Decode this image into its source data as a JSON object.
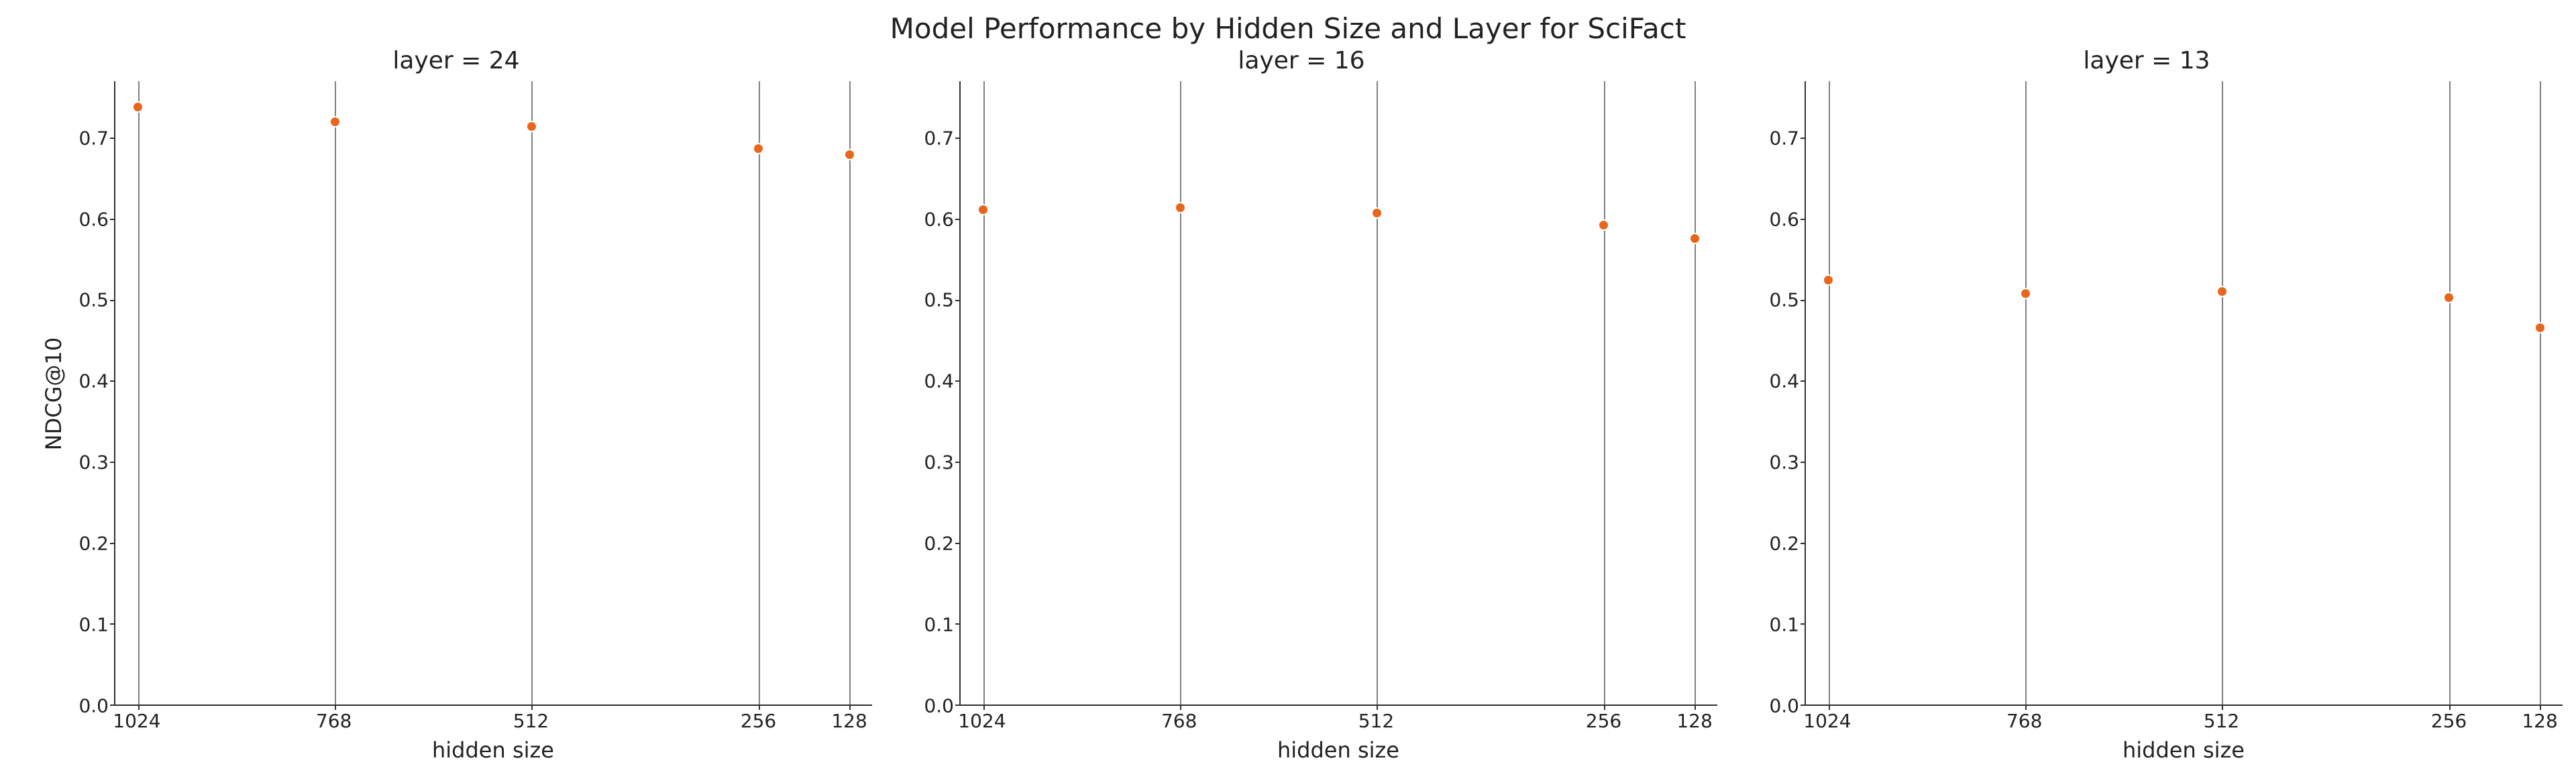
{
  "suptitle": "Model Performance by Hidden Size and Layer for SciFact",
  "ylabel": "NDCG@10",
  "xlabel": "hidden size",
  "yticks": [
    0.0,
    0.1,
    0.2,
    0.3,
    0.4,
    0.5,
    0.6,
    0.7
  ],
  "ylim": [
    0.0,
    0.77
  ],
  "categories": [
    "1024",
    "768",
    "512",
    "256",
    "128"
  ],
  "x_positions_pct": [
    3,
    29,
    55,
    85,
    97
  ],
  "point_color": "#e8651b",
  "panels": [
    {
      "title": "layer = 24",
      "values": [
        0.738,
        0.72,
        0.714,
        0.687,
        0.679
      ]
    },
    {
      "title": "layer = 16",
      "values": [
        0.611,
        0.614,
        0.607,
        0.592,
        0.576
      ]
    },
    {
      "title": "layer = 13",
      "values": [
        0.524,
        0.508,
        0.51,
        0.503,
        0.465
      ]
    }
  ],
  "chart_data": [
    {
      "type": "scatter",
      "title": "layer = 24",
      "xlabel": "hidden size",
      "ylabel": "NDCG@10",
      "ylim": [
        0.0,
        0.77
      ],
      "categories": [
        "1024",
        "768",
        "512",
        "256",
        "128"
      ],
      "values": [
        0.738,
        0.72,
        0.714,
        0.687,
        0.679
      ]
    },
    {
      "type": "scatter",
      "title": "layer = 16",
      "xlabel": "hidden size",
      "ylabel": "NDCG@10",
      "ylim": [
        0.0,
        0.77
      ],
      "categories": [
        "1024",
        "768",
        "512",
        "256",
        "128"
      ],
      "values": [
        0.611,
        0.614,
        0.607,
        0.592,
        0.576
      ]
    },
    {
      "type": "scatter",
      "title": "layer = 13",
      "xlabel": "hidden size",
      "ylabel": "NDCG@10",
      "ylim": [
        0.0,
        0.77
      ],
      "categories": [
        "1024",
        "768",
        "512",
        "256",
        "128"
      ],
      "values": [
        0.524,
        0.508,
        0.51,
        0.503,
        0.465
      ]
    }
  ]
}
